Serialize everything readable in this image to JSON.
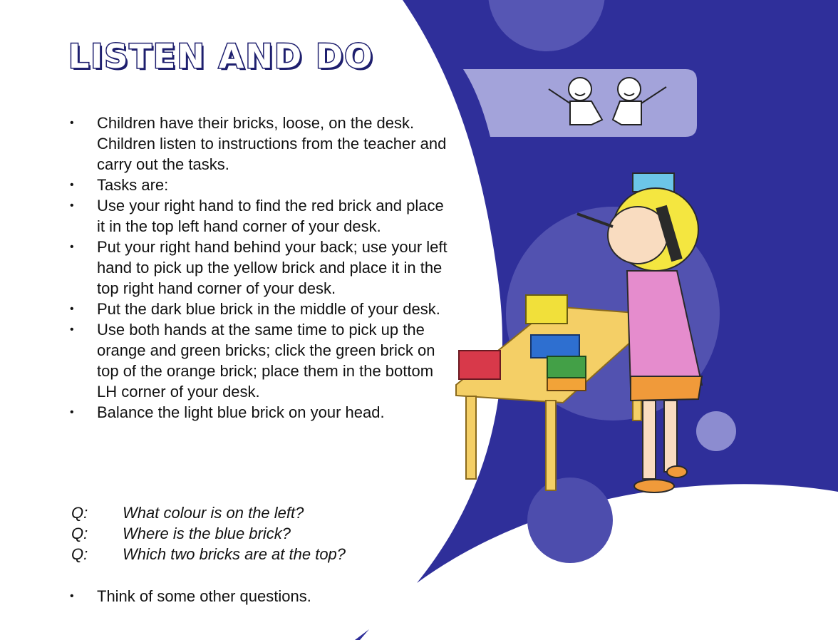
{
  "title": "LISTEN AND DO",
  "bullets": [
    "Children have their bricks, loose, on the desk. Children listen to instructions from the teacher and carry out the tasks.",
    "Tasks are:",
    "Use your right hand to find the red brick and place it in the top left hand corner of your desk.",
    "Put your right hand behind your back; use your left hand to pick up the yellow brick and place it in the top right hand corner of your desk.",
    "Put the dark blue brick in the middle of your desk.",
    "Use both hands at the same time to pick up the orange and green bricks; click the green brick on top of the orange brick; place them in the bottom LH corner of your desk.",
    "Balance the light blue brick on your head."
  ],
  "questions": [
    {
      "label": "Q:",
      "text": "What colour is on the left?"
    },
    {
      "label": "Q:",
      "text": "Where is the blue brick?"
    },
    {
      "label": "Q:",
      "text": "Which two bricks are at the top?"
    }
  ],
  "final_bullet": "Think of some other questions.",
  "colors": {
    "panel_blue": "#2f2f9a",
    "panel_light": "#9a9ad6",
    "circle": "#5656b4",
    "brick_red": "#d8394a",
    "brick_yellow": "#f1e03a",
    "brick_dark_blue": "#2e6fd0",
    "brick_green": "#43a047",
    "brick_orange": "#f2a338",
    "brick_light_blue": "#6cc5e8"
  },
  "icons": [
    "two-children-logo-icon",
    "girl-with-brick-illustration",
    "desk-with-bricks-illustration"
  ]
}
